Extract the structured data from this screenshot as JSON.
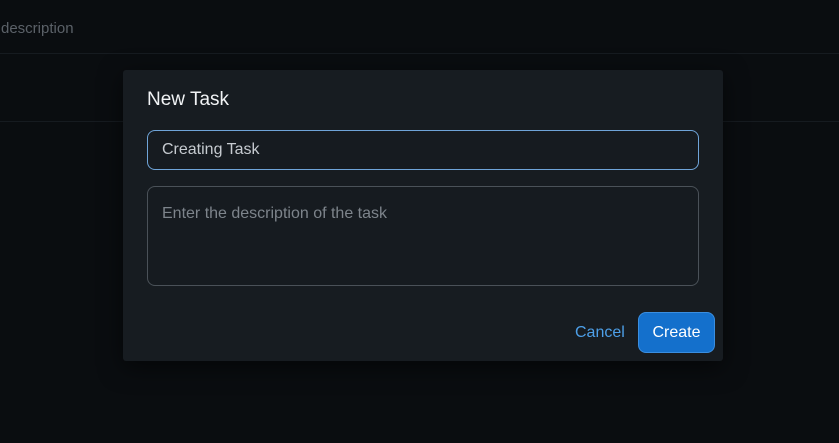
{
  "background": {
    "header_text": "description"
  },
  "modal": {
    "title": "New Task",
    "title_input": {
      "value": "Creating Task",
      "placeholder": ""
    },
    "description_input": {
      "value": "",
      "placeholder": "Enter the description of the task"
    },
    "cancel_label": "Cancel",
    "create_label": "Create"
  },
  "colors": {
    "accent": "#1470cc",
    "link": "#4d9fe8",
    "focus_border": "#6fa4d8",
    "modal_bg": "#171c21",
    "page_bg": "#0a0d10"
  }
}
